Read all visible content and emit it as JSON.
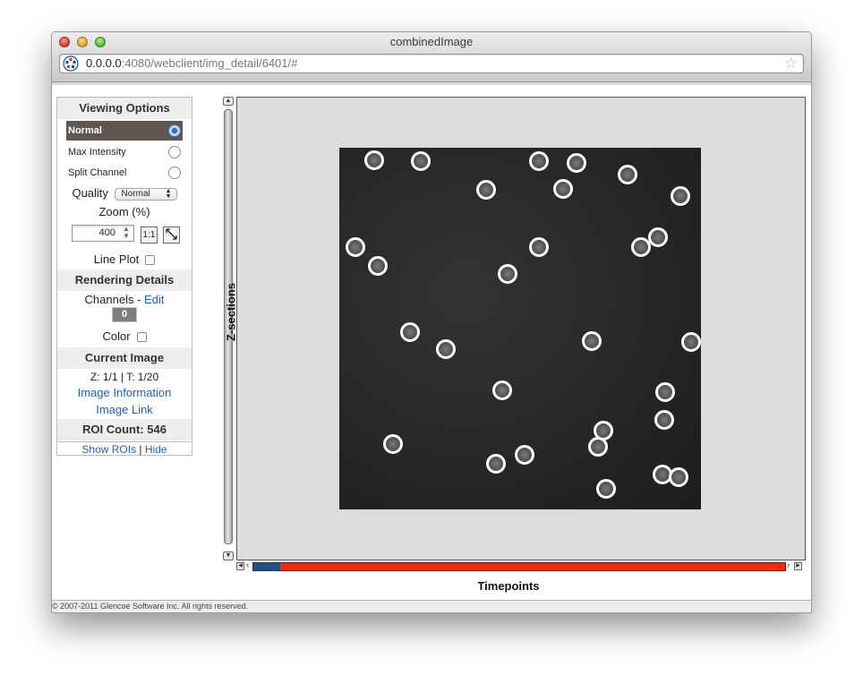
{
  "window": {
    "title": "combinedImage"
  },
  "address": {
    "host": "0.0.0.0",
    "path": ":4080/webclient/img_detail/6401/#"
  },
  "panel": {
    "viewing_options": "Viewing Options",
    "modes": [
      {
        "label": "Normal",
        "selected": true
      },
      {
        "label": "Max Intensity",
        "selected": false
      },
      {
        "label": "Split Channel",
        "selected": false
      }
    ],
    "quality_label": "Quality",
    "quality_value": "Normal",
    "zoom_label": "Zoom (%)",
    "zoom_value": "400",
    "zoom_actual": "1:1",
    "line_plot_label": "Line Plot",
    "rendering_details": "Rendering Details",
    "channels_label": "Channels - ",
    "channels_edit": "Edit",
    "channel_badge": "0",
    "color_label": "Color",
    "current_image": "Current Image",
    "z_t": "Z: 1/1 | T: 1/20",
    "image_information": "Image Information",
    "image_link": "Image Link",
    "roi_count": "ROI Count: 546",
    "show_rois": "Show ROIs",
    "separator": " | ",
    "hide": "Hide"
  },
  "viewer": {
    "z_label": "Z-sections",
    "t_label": "Timepoints",
    "timepoint_progress": 0.05
  },
  "footer": "© 2007-2011 Glencoe Software Inc. All rights reserved.",
  "colors": {
    "selected_row": "#5f5650",
    "link": "#1d63b8",
    "timeline": "#ff2600",
    "timeline_fill": "#1f4f8f"
  }
}
